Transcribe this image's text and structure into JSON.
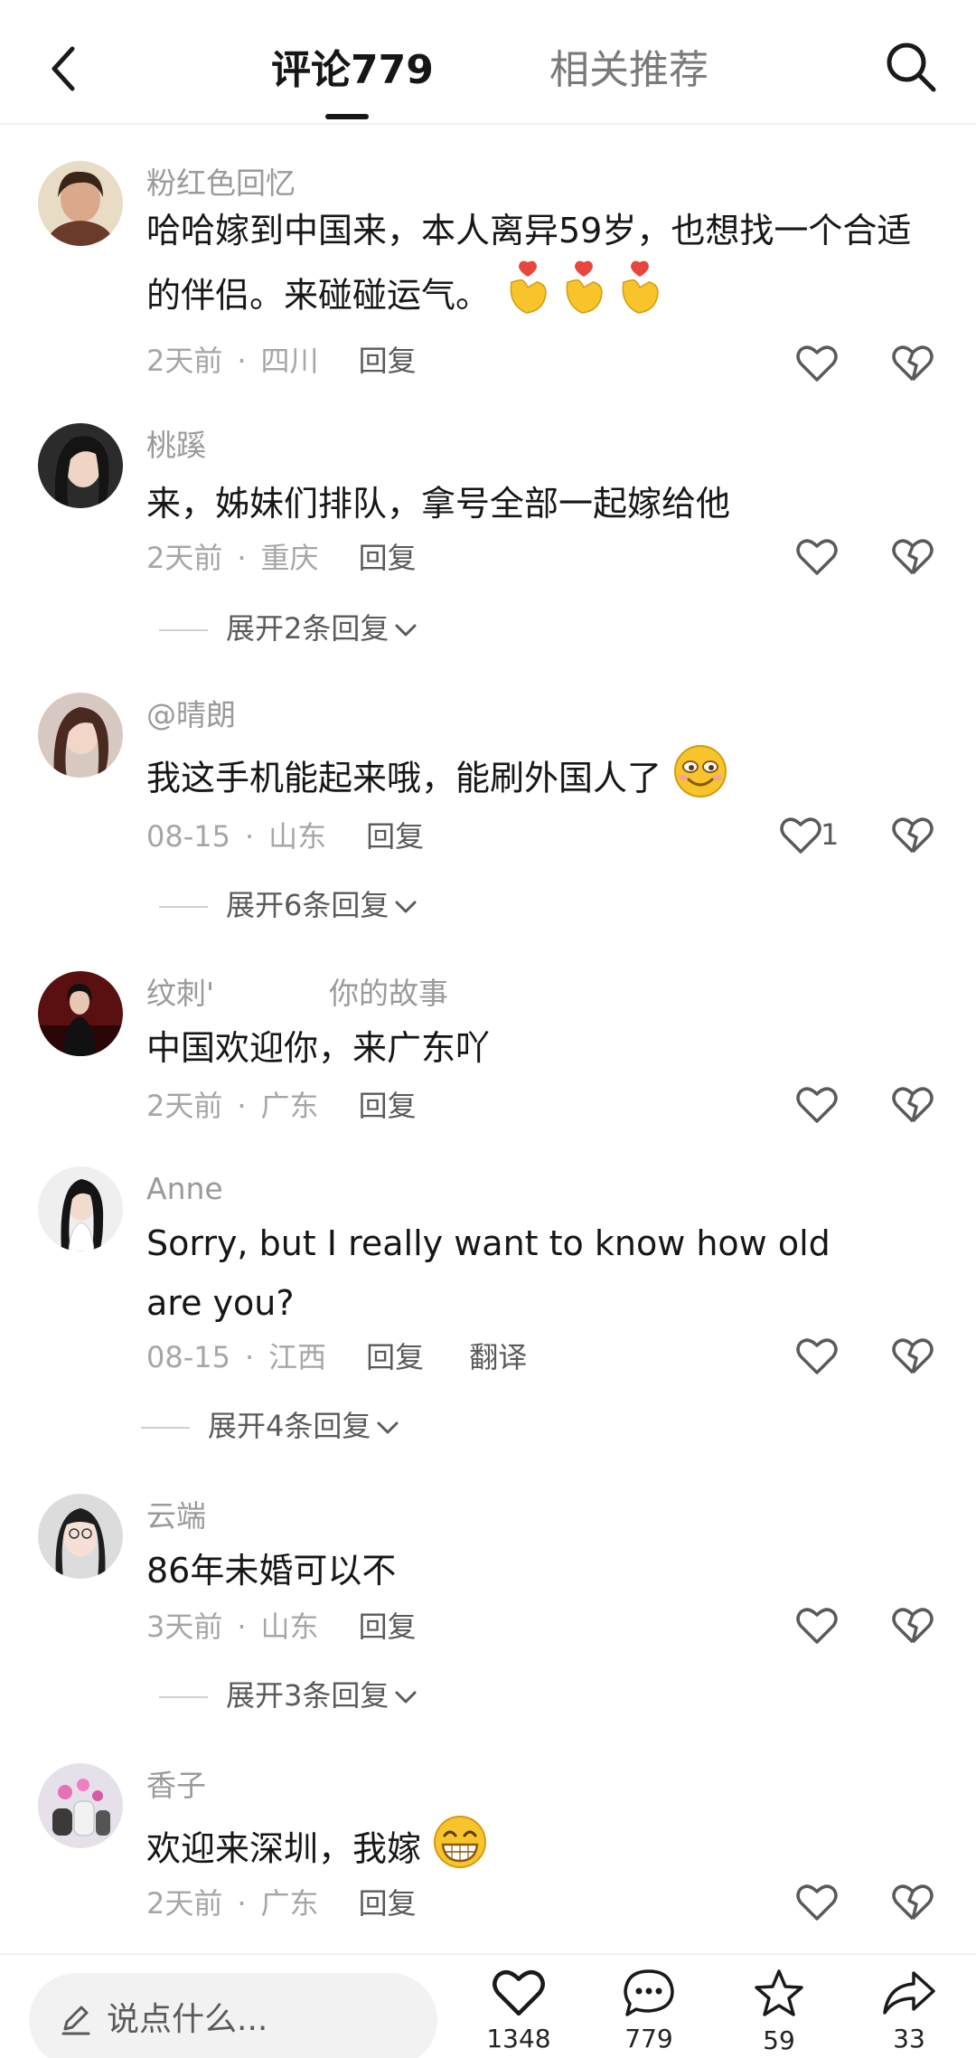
{
  "header": {
    "tab_comments": "评论779",
    "tab_related": "相关推荐"
  },
  "comments": [
    {
      "name": "粉红色回忆",
      "text": "哈哈嫁到中国来，本人离异59岁，也想找一个合适的伴侣。来碰碰运气。",
      "emoji": "finger-heart-emoji x3",
      "time": "2天前",
      "location": "四川",
      "reply": "回复"
    },
    {
      "name": "桃蹊",
      "text": "来，姊妹们排队，拿号全部一起嫁给他",
      "time": "2天前",
      "location": "重庆",
      "reply": "回复",
      "expand": "展开2条回复"
    },
    {
      "name": "@晴朗",
      "text": "我这手机能起来哦，能刷外国人了",
      "emoji": "smiling-face-emoji",
      "time": "08-15",
      "location": "山东",
      "reply": "回复",
      "likes": "1",
      "expand": "展开6条回复"
    },
    {
      "name": "纹刺'",
      "tag": "你的故事",
      "text": "中国欢迎你，来广东吖",
      "time": "2天前",
      "location": "广东",
      "reply": "回复"
    },
    {
      "name": "Anne",
      "text": "Sorry, but I really want to know how old are you?",
      "time": "08-15",
      "location": "江西",
      "reply": "回复",
      "translate": "翻译",
      "expand": "展开4条回复"
    },
    {
      "name": "云端",
      "text": "86年未婚可以不",
      "time": "3天前",
      "location": "山东",
      "reply": "回复",
      "expand": "展开3条回复"
    },
    {
      "name": "香子",
      "text": "欢迎来深圳，我嫁",
      "emoji": "grinning-face-emoji",
      "time": "2天前",
      "location": "广东",
      "reply": "回复"
    }
  ],
  "meta_separator": "·",
  "bottom_bar": {
    "input_placeholder": "说点什么...",
    "likes": "1348",
    "comments": "779",
    "favorites": "59",
    "shares": "33"
  },
  "colors": {
    "primary_text": "#161616",
    "secondary_text": "#9a9a9a",
    "link_text": "#5a5a5a",
    "emoji_yellow": "#f7c52b",
    "emoji_heart": "#e8453c"
  }
}
